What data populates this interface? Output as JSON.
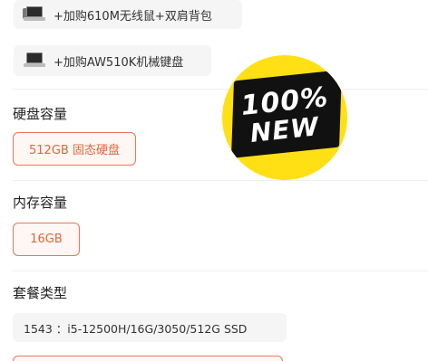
{
  "addons": [
    {
      "label": "+加购610M无线鼠+双肩背包",
      "thumb": "laptop-bundle-icon"
    },
    {
      "label": "+加购AW510K机械键盘",
      "thumb": "laptop-keyboard-icon"
    }
  ],
  "storage": {
    "title": "硬盘容量",
    "selected": "512GB 固态硬盘"
  },
  "memory": {
    "title": "内存容量",
    "selected": "16GB"
  },
  "package": {
    "title": "套餐类型",
    "option": "1543 ：i5-12500H/16G/3050/512G SSD"
  },
  "badge": {
    "line1": "100%",
    "line2": "NEW",
    "bg_color": "#ffe014",
    "band_color": "#111111"
  },
  "accent_color": "#e8775a"
}
